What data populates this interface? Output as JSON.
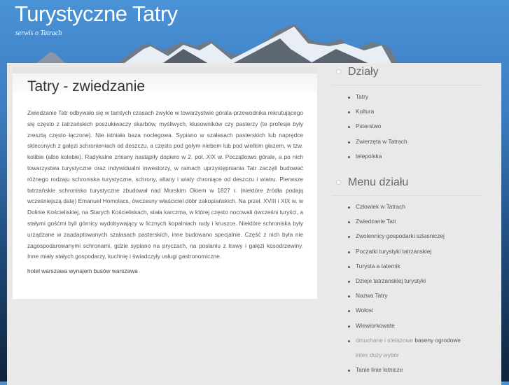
{
  "header": {
    "title": "Turystyczne Tatry",
    "subtitle": "serwis o Tatrach"
  },
  "main": {
    "title": "Tatry - zwiedzanie",
    "body": "Zwiedzanie Tatr odbywało się w tamtych czasach zwykle w towarzystwie górala-przewodnika rekrutującego się często z tatrzańskich poszukiwaczy skarbów, myśliwych, kłusowników czy pasterzy (te profesje były zresztą często łączone). Nie istniała baza noclegowa. Sypiano w szałasach pasterskich lub naprędce skleconych z gałęzi schronieniach od deszczu, a często pod gołym niebem lub pod wielkim głazem, w tzw. kolibie (albo kolebie). Radykalne zmiany nastąpiły dopiero w 2. poł. XIX w. Początkowo górale, a po nich towarzystwa turystyczne oraz indywidualni inwestorzy, w ramach uprzystępniania Tatr zaczęli budować różnego rodzaju schroniska turystyczne, schrony, altany i wiaty chroniące od deszczu i wiatru. Pierwsze tatrzańskie schronisko turystyczne zbudował nad Morskim Okiem w 1827 r. (niektóre źródła podają wcześniejszą datę) Emanuel Homolacs, ówczesny właściciel dóbr zakopiańskich. Na przeł. XVIII i XIX w. w Dolinie Kościeliskiej, na Starych Kościeliskach, stała karczma, w której często nocowali ówcześni turyści, a stałymi gośćmi byli górnicy wydobywający w licznych kopalniach rudy i kruszce. Niektóre schroniska były urządzane w zaadaptowanych szałasach pasterskich, inne budowano specjalnie. Część z nich była nie zagospodarowanymi schronami, gdzie sypiano na pryczach, na posłaniu z trawy i gałęzi kosodrzewiny. Inne miały stałych gospodarzy, kuchnię i świadczyły usługi gastronomiczne.",
    "link1": "hotel warszawa",
    "link2": "wynajem busów warszawa"
  },
  "sidebar": {
    "dzialy_title": "Działy",
    "dzialy": [
      "Tatry",
      "Kultura",
      "Psterstwo",
      "Zwierzęta w Tatrach",
      "telepolska"
    ],
    "menu_title": "Menu działu",
    "menu": [
      "Człowiek w Tatrach",
      "Zwiedzanie Tatr",
      "Zwolennicy gospodarki szlasniczej",
      "Poczatki turystyki tatrzanskiej",
      "Turysta a taternik",
      "Dzieje tatrzanskiej turystyki",
      "Nazwa Tatry",
      "Wołosi",
      "Wiewiorkowate"
    ],
    "ad": {
      "pre": "dmuchane i stelażowe",
      "link": "baseny ogrodowe",
      "line2": "intex duży wybór"
    },
    "last": "Tanie linie lotnicze"
  }
}
